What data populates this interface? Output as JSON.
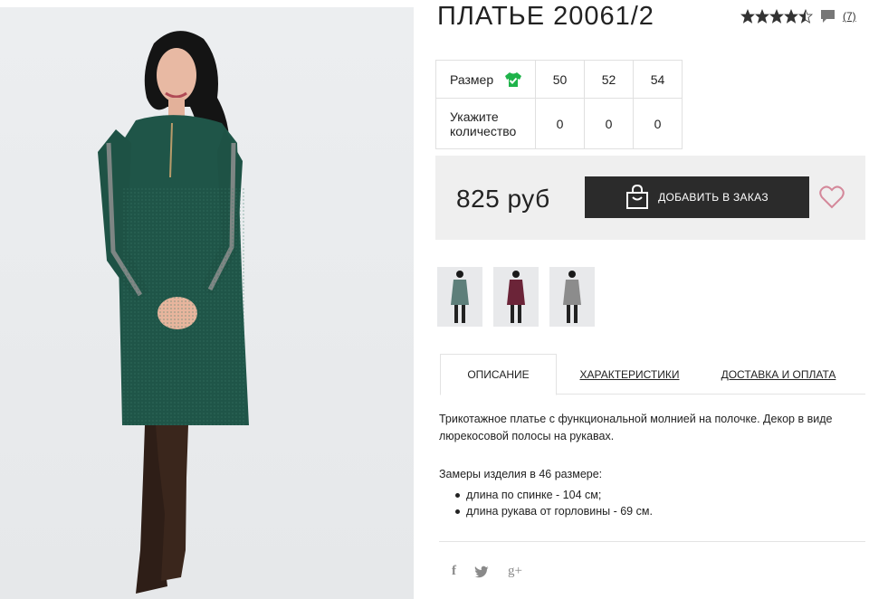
{
  "product": {
    "title": "ПЛАТЬЕ 20061/2",
    "rating_value": 4.5,
    "rating_max": 5,
    "review_count": "(7)"
  },
  "size_table": {
    "size_label": "Размер",
    "qty_label": "Укажите количество",
    "sizes": [
      "50",
      "52",
      "54"
    ],
    "quantities": [
      "0",
      "0",
      "0"
    ]
  },
  "price": {
    "amount": "825 руб",
    "order_button": "ДОБАВИТЬ В ЗАКАЗ"
  },
  "thumbnails": [
    {
      "color": "#5e7f7a"
    },
    {
      "color": "#6b2438"
    },
    {
      "color": "#8c8c8c"
    }
  ],
  "tabs": {
    "description": "ОПИСАНИЕ",
    "characteristics": "ХАРАКТЕРИСТИКИ",
    "delivery": "ДОСТАВКА И ОПЛАТА"
  },
  "description": {
    "text": "Трикотажное платье с функциональной молнией на полочке. Декор в виде люрекосовой полосы на рукавах.",
    "measure_title": "Замеры изделия в 46 размере:",
    "measures": [
      "длина по спинке - 104 см;",
      "длина рукава от горловины - 69 см."
    ]
  },
  "social": {
    "facebook": "f",
    "twitter": "twitter-icon",
    "google": "g+"
  },
  "colors": {
    "dress": "#1f5548",
    "button": "#2b2b2b",
    "heart": "#d4889a",
    "shirt_icon": "#1fb34a",
    "price_bg": "#efefef"
  }
}
